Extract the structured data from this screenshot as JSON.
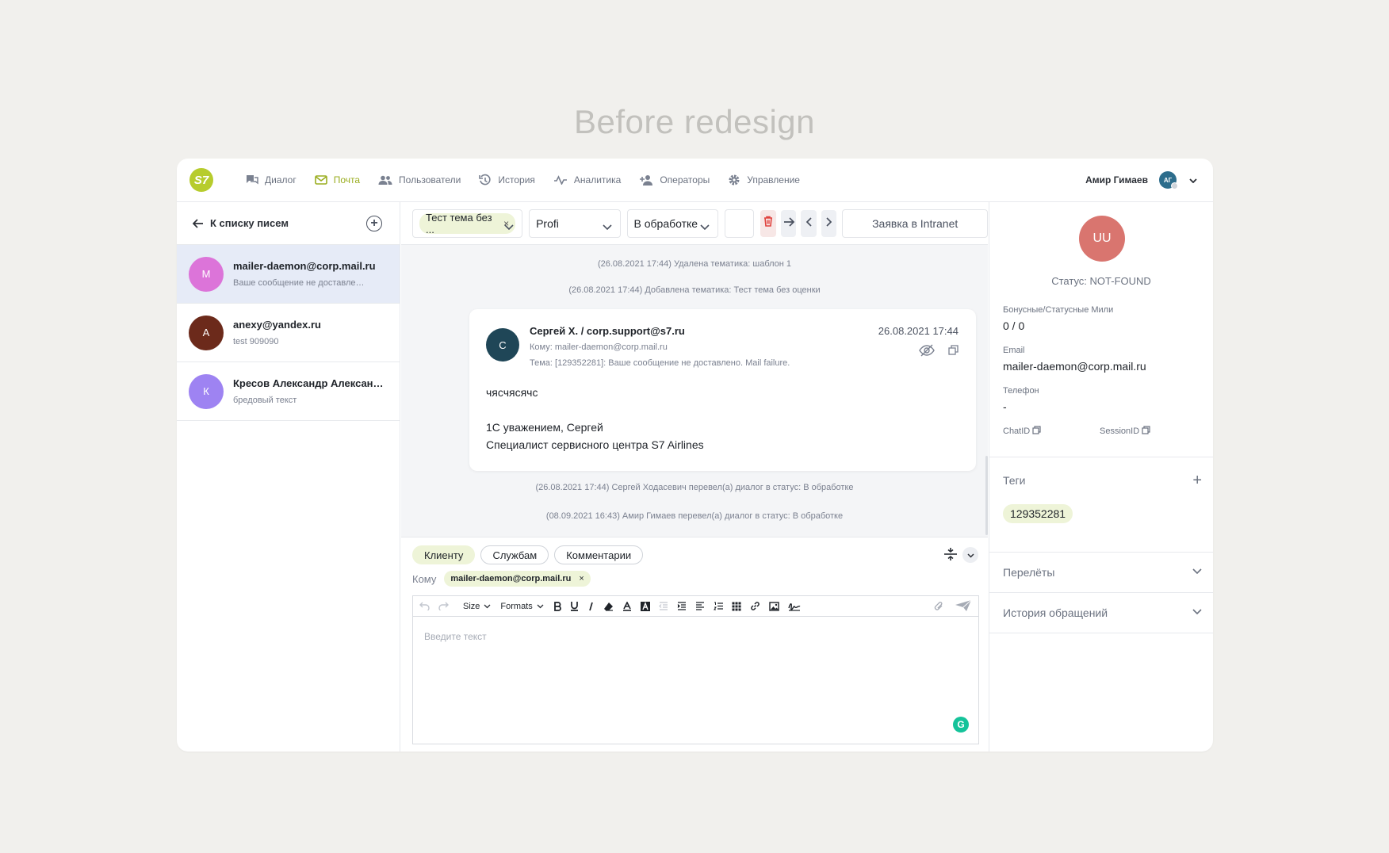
{
  "heading": "Before redesign",
  "logo": "S7",
  "nav": [
    {
      "label": "Диалог",
      "icon": "chat-icon"
    },
    {
      "label": "Почта",
      "icon": "mail-icon",
      "active": true
    },
    {
      "label": "Пользователи",
      "icon": "users-icon"
    },
    {
      "label": "История",
      "icon": "history-icon"
    },
    {
      "label": "Аналитика",
      "icon": "analytics-icon"
    },
    {
      "label": "Операторы",
      "icon": "add-user-icon"
    },
    {
      "label": "Управление",
      "icon": "gear-icon"
    }
  ],
  "user": {
    "name": "Амир Гимаев",
    "initials": "АГ"
  },
  "left": {
    "back_label": "К списку писем",
    "add": "+",
    "conversations": [
      {
        "initial": "M",
        "name": "mailer-daemon@corp.mail.ru",
        "preview": "Ваше сообщение не доставлено. Mail failure.",
        "color": "#dc74d9"
      },
      {
        "initial": "A",
        "name": "anexy@yandex.ru",
        "preview": "test 909090",
        "color": "#6c2a1b"
      },
      {
        "initial": "К",
        "name": "Кресов Александр Александрович",
        "preview": "бредовый текст",
        "color": "#9e83f2"
      }
    ]
  },
  "toolbar": {
    "topic_chip": "Тест тема без ...",
    "chip_close": "×",
    "group": "Profi",
    "status": "В обработке",
    "intranet": "Заявка в Intranet"
  },
  "feed": {
    "sys1": "(26.08.2021 17:44) Удалена тематика: шаблон 1",
    "sys2": "(26.08.2021 17:44) Добавлена тематика: Тест тема без оценки",
    "message": {
      "initial": "С",
      "from": "Сергей Х. / corp.support@s7.ru",
      "to": "Кому: mailer-daemon@corp.mail.ru",
      "subject": "Тема: [129352281]: Ваше сообщение не доставлено. Mail failure.",
      "date": "26.08.2021 17:44",
      "line1": "чясчясячс",
      "line2": "1С уважением, Сергей",
      "line3": "Специалист сервисного центра S7 Airlines"
    },
    "sys3": "(26.08.2021 17:44) Сергей Ходасевич перевел(а) диалог в статус: В обработке",
    "sys4": "(08.09.2021 16:43) Амир Гимаев перевел(а) диалог в статус: В обработке"
  },
  "composer": {
    "tabs": [
      "Клиенту",
      "Службам",
      "Комментарии"
    ],
    "to_label": "Кому",
    "to_value": "mailer-daemon@corp.mail.ru",
    "to_close": "×",
    "size_label": "Size",
    "formats_label": "Formats",
    "placeholder": "Введите текст",
    "grammarly": "G"
  },
  "profile": {
    "initials": "UU",
    "status": "Статус: NOT-FOUND",
    "miles_label": "Бонусные/Статусные Мили",
    "miles_value": "0 / 0",
    "email_label": "Email",
    "email_value": "mailer-daemon@corp.mail.ru",
    "phone_label": "Телефон",
    "phone_value": "-",
    "chatid": "ChatID",
    "sessionid": "SessionID"
  },
  "tags": {
    "title": "Теги",
    "plus": "+",
    "items": [
      "129352281"
    ]
  },
  "accordions": [
    "Перелёты",
    "История обращений"
  ],
  "colors": {
    "brand": "#b7cc2d",
    "active_nav": "#9aad1f",
    "selected_row": "#e6ebf7",
    "chip": "#eef4d8"
  }
}
